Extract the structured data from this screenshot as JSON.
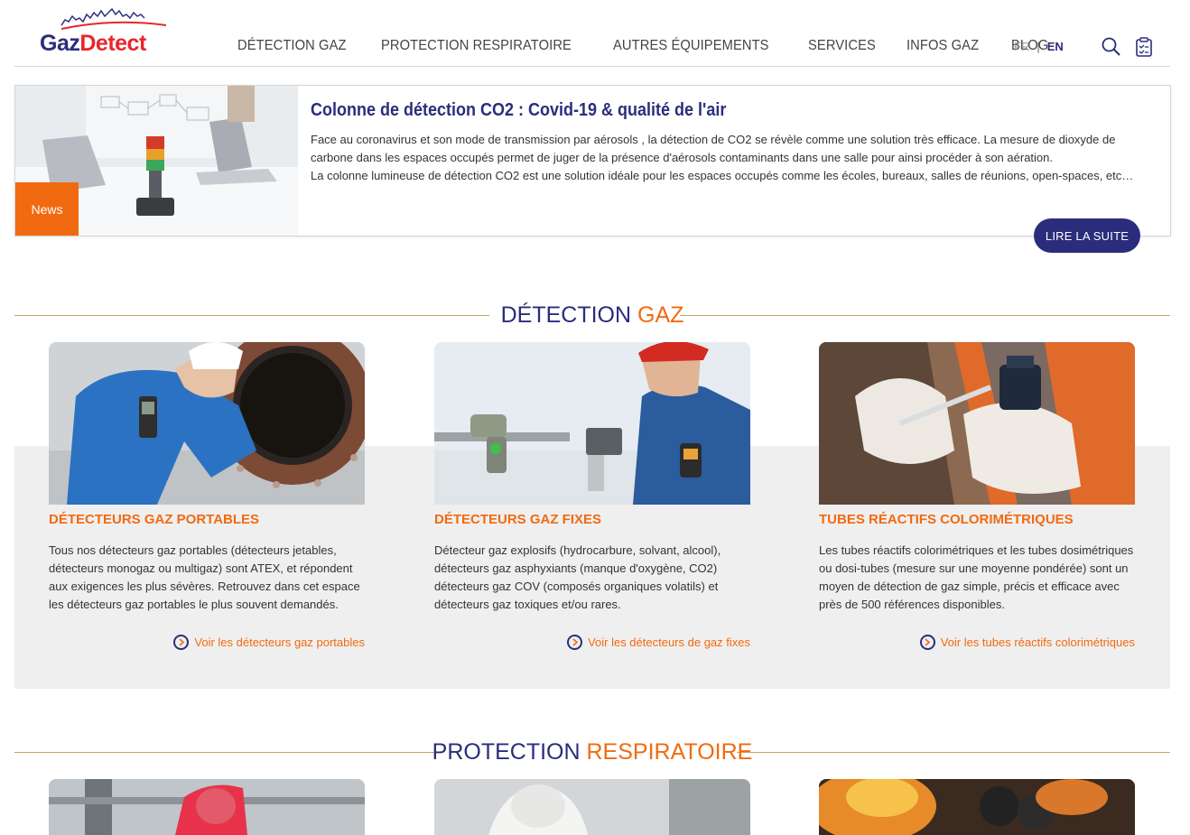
{
  "brand": {
    "logo_part1": "Gaz",
    "logo_part2": "Detect"
  },
  "nav": {
    "items": [
      "DÉTECTION GAZ",
      "PROTECTION RESPIRATOIRE",
      "AUTRES ÉQUIPEMENTS",
      "SERVICES",
      "INFOS GAZ",
      "BLOG"
    ]
  },
  "lang": {
    "fr": "FR",
    "sep": "|",
    "en": "EN"
  },
  "news": {
    "tag": "News",
    "title": "Colonne de détection CO2 : Covid-19 & qualité de l'air",
    "paragraph1": "Face au coronavirus et son mode de transmission par aérosols , la détection de CO2 se révèle comme une solution très efficace. La mesure de dioxyde de carbone dans les espaces occupés permet de juger de la présence d'aérosols contaminants dans une salle pour ainsi procéder à son aération.",
    "paragraph2": "La colonne lumineuse de détection CO2 est une solution idéale pour les espaces occupés comme les écoles, bureaux, salles de réunions, open-spaces, etc…",
    "button": "LIRE LA SUITE"
  },
  "section1": {
    "title_part1": "DÉTECTION",
    "title_part2": "GAZ"
  },
  "cards": [
    {
      "title": "DÉTECTEURS GAZ PORTABLES",
      "text": "Tous nos détecteurs gaz portables (détecteurs jetables, détecteurs monogaz ou multigaz) sont ATEX, et répondent aux exigences les plus sévères. Retrouvez dans cet espace les détecteurs gaz portables le plus souvent demandés.",
      "link": "Voir les détecteurs gaz portables"
    },
    {
      "title": "DÉTECTEURS GAZ FIXES",
      "text": "Détecteur gaz explosifs (hydrocarbure, solvant, alcool), détecteurs gaz asphyxiants (manque d'oxygène, CO2) détecteurs gaz COV (composés organiques volatils) et détecteurs gaz toxiques et/ou rares.",
      "link": "Voir les détecteurs de gaz fixes"
    },
    {
      "title": "TUBES RÉACTIFS COLORIMÉTRIQUES",
      "text": "Les tubes réactifs colorimétriques et les tubes dosimétriques ou dosi-tubes (mesure sur une moyenne pondérée) sont un moyen de détection de gaz simple, précis et efficace avec près de 500 références disponibles.",
      "link": "Voir les tubes réactifs colorimétriques"
    }
  ],
  "section2": {
    "title_part1": "PROTECTION",
    "title_part2": "RESPIRATOIRE"
  },
  "colors": {
    "navy": "#2b2d7c",
    "orange": "#f26a10",
    "gold_line": "#c9a466",
    "band": "#efefef"
  }
}
